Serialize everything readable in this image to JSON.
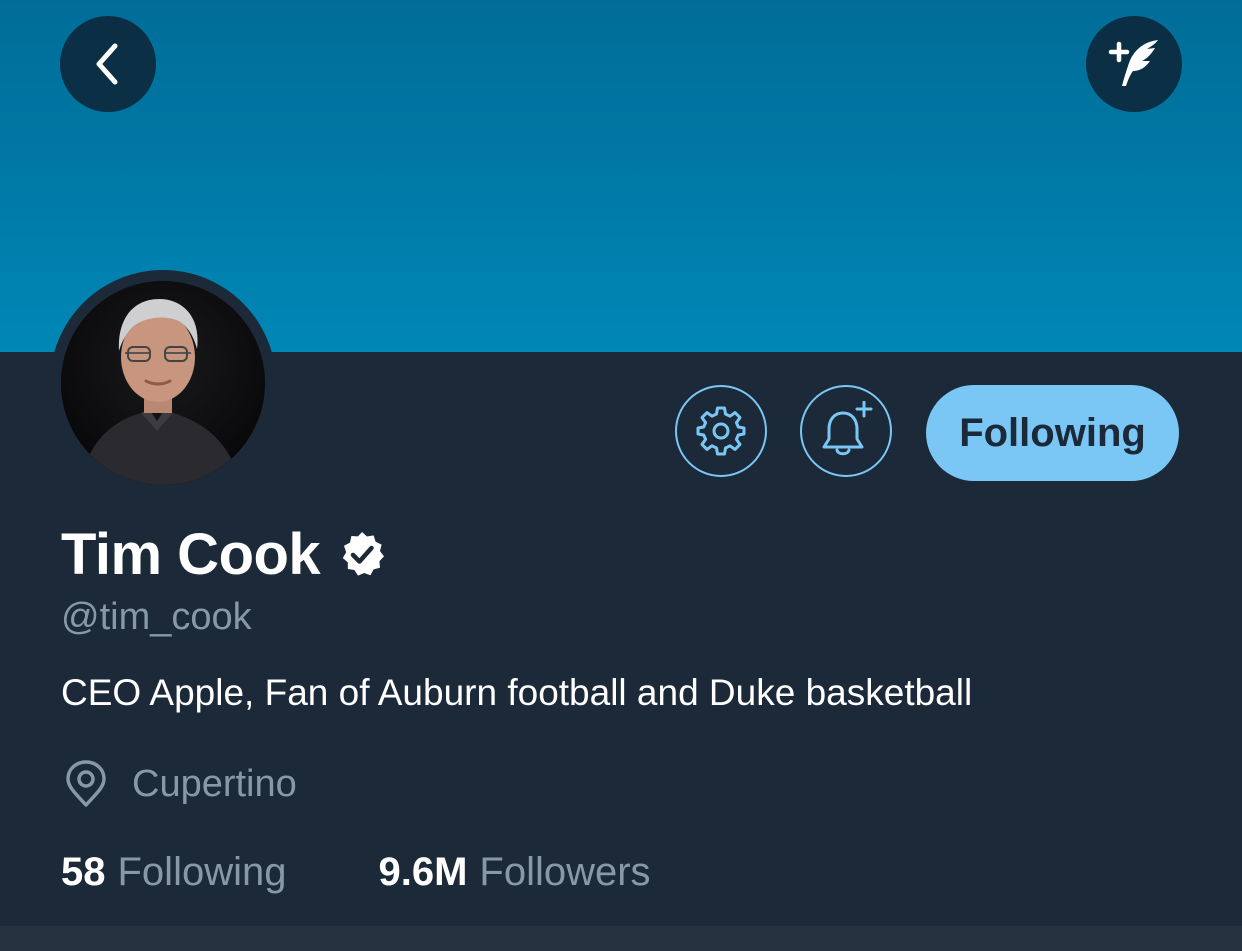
{
  "colors": {
    "banner": "#0079a6",
    "background": "#1c2938",
    "accent": "#7ac7f5",
    "secondary_text": "#8899a6",
    "primary_text": "#ffffff"
  },
  "header": {
    "back_icon": "chevron-left-icon",
    "compose_icon": "compose-feather-icon"
  },
  "profile": {
    "display_name": "Tim Cook",
    "verified": true,
    "handle": "@tim_cook",
    "bio": "CEO Apple, Fan of Auburn football and Duke basketball",
    "location": "Cupertino"
  },
  "actions": {
    "settings_icon": "gear-icon",
    "notify_icon": "bell-plus-icon",
    "follow_state_label": "Following"
  },
  "stats": {
    "following_count": "58",
    "following_label": "Following",
    "followers_count": "9.6M",
    "followers_label": "Followers"
  }
}
